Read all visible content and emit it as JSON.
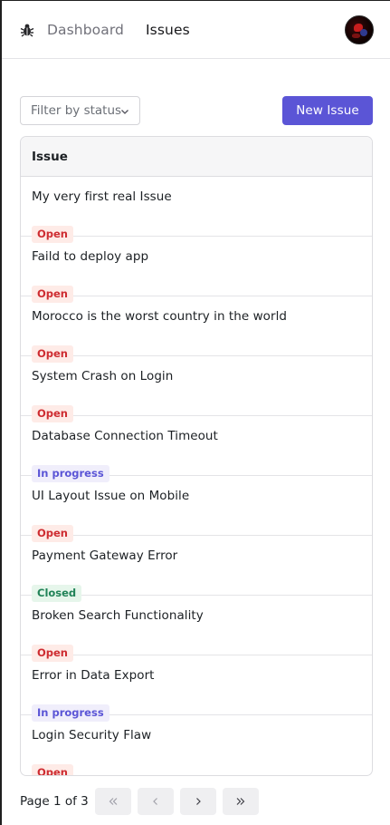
{
  "nav": {
    "logo_icon": "bug-icon",
    "links": [
      "Dashboard",
      "Issues"
    ],
    "avatar": "user-avatar"
  },
  "toolbar": {
    "filter_label": "Filter by status",
    "new_issue_label": "New Issue",
    "accent_color": "#5b55d6"
  },
  "table": {
    "header": "Issue",
    "rows": [
      {
        "title": "My very first real Issue",
        "status": "Open"
      },
      {
        "title": "Faild to deploy app",
        "status": "Open"
      },
      {
        "title": "Morocco is the worst country in the world",
        "status": "Open"
      },
      {
        "title": "System Crash on Login",
        "status": "Open"
      },
      {
        "title": "Database Connection Timeout",
        "status": "In progress"
      },
      {
        "title": "UI Layout Issue on Mobile",
        "status": "Open"
      },
      {
        "title": "Payment Gateway Error",
        "status": "Closed"
      },
      {
        "title": "Broken Search Functionality",
        "status": "Open"
      },
      {
        "title": "Error in Data Export",
        "status": "In progress"
      },
      {
        "title": "Login Security Flaw",
        "status": "Open"
      }
    ]
  },
  "pagination": {
    "label": "Page 1 of 3",
    "buttons": [
      "first-page-icon",
      "previous-page-icon",
      "next-page-icon",
      "last-page-icon"
    ]
  }
}
